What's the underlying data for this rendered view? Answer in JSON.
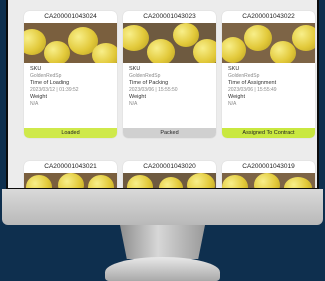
{
  "cards": [
    {
      "title": "CA200001043024",
      "sku_label": "SKU",
      "sku": "GoldenRedSp",
      "time_label": "Time of Loading",
      "time": "2023/03/12 | 01:39:52",
      "weight_label": "Weight",
      "weight": "N/A",
      "status": "Loaded",
      "status_color": "#cfe94b"
    },
    {
      "title": "CA200001043023",
      "sku_label": "SKU",
      "sku": "GoldenRedSp",
      "time_label": "Time of Packing",
      "time": "2023/03/06 | 15:55:50",
      "weight_label": "Weight",
      "weight": "N/A",
      "status": "Packed",
      "status_color": "#d0d0d0"
    },
    {
      "title": "CA200001043022",
      "sku_label": "SKU",
      "sku": "GoldenRedSp",
      "time_label": "Time of Assignment",
      "time": "2023/03/06 | 15:55:49",
      "weight_label": "Weight",
      "weight": "N/A",
      "status": "Assigned To Contract",
      "status_color": "#c9e840"
    },
    {
      "title": "CA200001043021"
    },
    {
      "title": "CA200001043020"
    },
    {
      "title": "CA200001043019"
    }
  ],
  "colors": {
    "background": "#0e2f4e",
    "screen": "#ececec",
    "accent": "#cfe94b"
  }
}
